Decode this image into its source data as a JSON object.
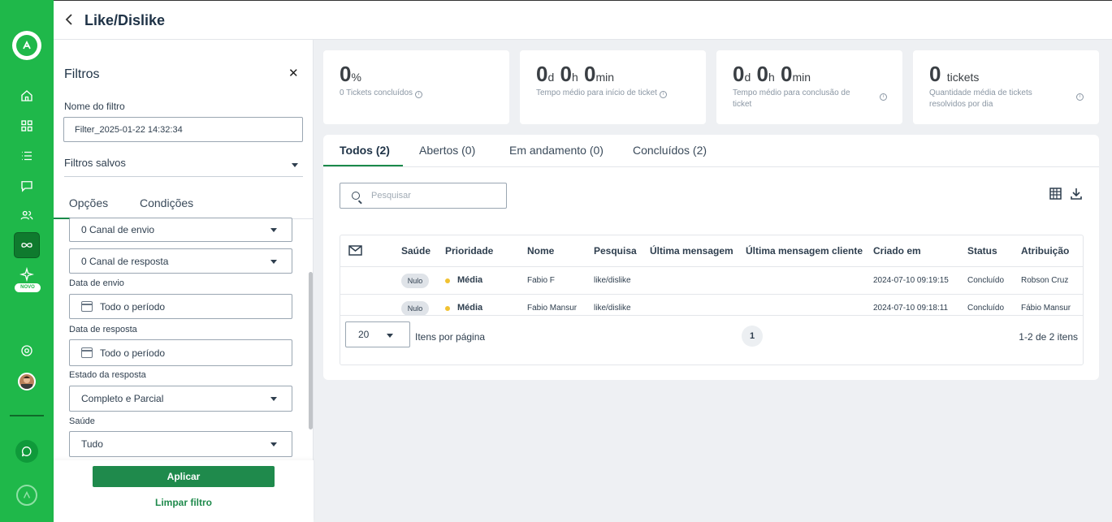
{
  "header": {
    "title": "Like/Dislike"
  },
  "rail": {
    "new_badge": "NOVO"
  },
  "filters": {
    "title": "Filtros",
    "filter_name_label": "Nome do filtro",
    "filter_name_value": "Filter_2025-01-22 14:32:34",
    "saved_filters_label": "Filtros salvos",
    "tabs": [
      "Opções",
      "Condições"
    ],
    "channel_send": "0 Canal de envio",
    "channel_reply": "0 Canal de resposta",
    "send_date_label": "Data de envio",
    "send_date_value": "Todo o período",
    "reply_date_label": "Data de resposta",
    "reply_date_value": "Todo o período",
    "reply_state_label": "Estado da resposta",
    "reply_state_value": "Completo e Parcial",
    "health_label": "Saúde",
    "health_value": "Tudo",
    "apply": "Aplicar",
    "clear": "Limpar filtro"
  },
  "stats": [
    {
      "value": "0",
      "unit": "%",
      "label": "0 Tickets concluídos"
    },
    {
      "d": "0",
      "h": "0",
      "m": "0",
      "d_unit": "d",
      "h_unit": "h",
      "m_unit": "min",
      "label": "Tempo médio para início de ticket"
    },
    {
      "d": "0",
      "h": "0",
      "m": "0",
      "d_unit": "d",
      "h_unit": "h",
      "m_unit": "min",
      "label": "Tempo médio para conclusão de ticket"
    },
    {
      "value": "0",
      "unit": "tickets",
      "label": "Quantidade média de tickets resolvidos por dia"
    }
  ],
  "tabs": [
    "Todos (2)",
    "Abertos (0)",
    "Em andamento (0)",
    "Concluídos (2)"
  ],
  "search": {
    "placeholder": "Pesquisar"
  },
  "table": {
    "columns": [
      "Saúde",
      "Prioridade",
      "Nome",
      "Pesquisa",
      "Última mensagem",
      "Última mensagem cliente",
      "Criado em",
      "Status",
      "Atribuição"
    ],
    "rows": [
      {
        "health": "Nulo",
        "priority": "Média",
        "name": "Fabio F",
        "survey": "like/dislike",
        "last_msg": "",
        "last_client_msg": "",
        "created": "2024-07-10 09:19:15",
        "status": "Concluído",
        "assignee": "Robson Cruz"
      },
      {
        "health": "Nulo",
        "priority": "Média",
        "name": "Fabio Mansur",
        "survey": "like/dislike",
        "last_msg": "",
        "last_client_msg": "",
        "created": "2024-07-10 09:18:11",
        "status": "Concluído",
        "assignee": "Fábio Mansur"
      }
    ]
  },
  "pagination": {
    "per_page": "20",
    "per_page_label": "Itens por página",
    "current_page": "1",
    "range": "1-2 de 2 itens"
  },
  "colors": {
    "brand": "#1fb84a",
    "accent": "#1f8a4c",
    "priority_medium": "#f1c232"
  }
}
